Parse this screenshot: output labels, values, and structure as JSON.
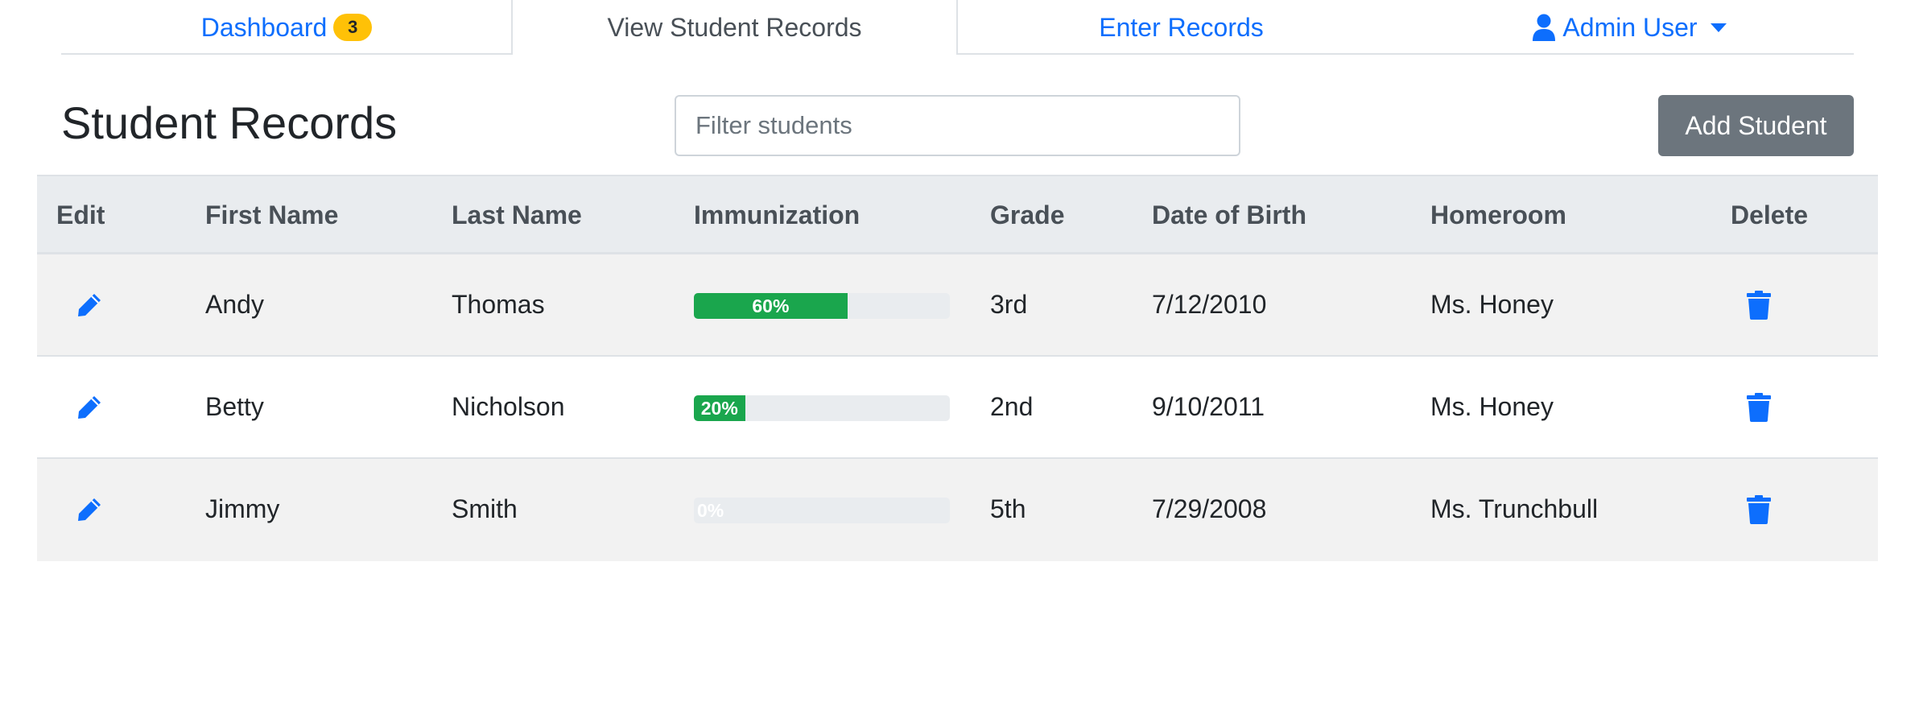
{
  "nav": {
    "tabs": [
      {
        "label": "Dashboard",
        "badge": "3"
      },
      {
        "label": "View Student Records"
      },
      {
        "label": "Enter Records"
      },
      {
        "label": "Admin User",
        "icon": "user-icon",
        "dropdown": true
      }
    ],
    "active_tab": "View Student Records"
  },
  "header": {
    "title": "Student Records",
    "filter_placeholder": "Filter students",
    "filter_value": "",
    "add_button_label": "Add Student"
  },
  "colors": {
    "link": "#0d6efd",
    "badge": "#ffc107",
    "progress": "#1aa64d",
    "button": "#6c757d"
  },
  "table": {
    "headers": [
      "Edit",
      "First Name",
      "Last Name",
      "Immunization",
      "Grade",
      "Date of Birth",
      "Homeroom",
      "Delete"
    ],
    "rows": [
      {
        "first_name": "Andy",
        "last_name": "Thomas",
        "immunization": 60,
        "immunization_label": "60%",
        "grade": "3rd",
        "dob": "7/12/2010",
        "homeroom": "Ms. Honey",
        "edit_icon": "pencil-icon",
        "delete_icon": "trash-icon"
      },
      {
        "first_name": "Betty",
        "last_name": "Nicholson",
        "immunization": 20,
        "immunization_label": "20%",
        "grade": "2nd",
        "dob": "9/10/2011",
        "homeroom": "Ms. Honey",
        "edit_icon": "pencil-icon",
        "delete_icon": "trash-icon"
      },
      {
        "first_name": "Jimmy",
        "last_name": "Smith",
        "immunization": 0,
        "immunization_label": "0%",
        "grade": "5th",
        "dob": "7/29/2008",
        "homeroom": "Ms. Trunchbull",
        "edit_icon": "pencil-icon",
        "delete_icon": "trash-icon"
      }
    ]
  }
}
